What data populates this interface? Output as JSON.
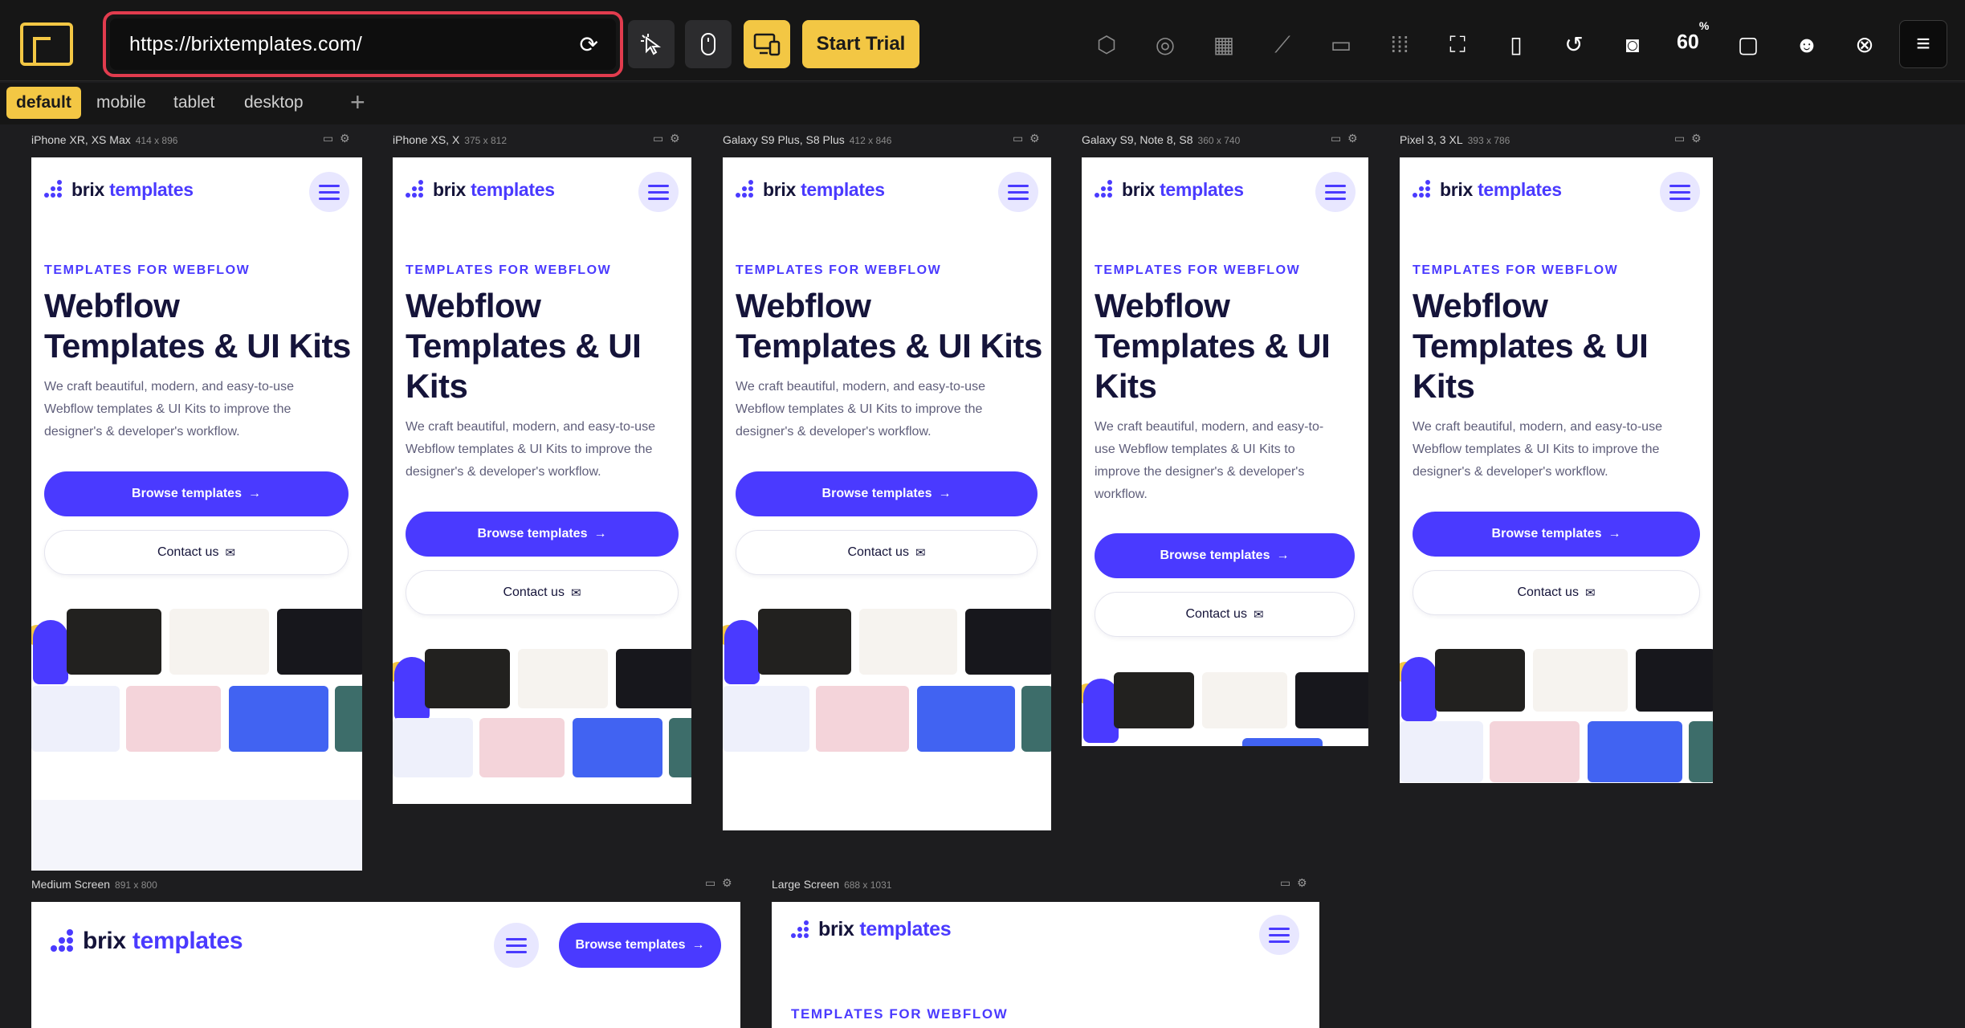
{
  "toolbar": {
    "url": "https://brixtemplates.com/",
    "start_trial_label": "Start Trial",
    "zoom_value": "60",
    "zoom_unit": "%",
    "icons": [
      "cube-icon",
      "layers-icon",
      "grid-icon",
      "ruler-icon",
      "minus-icon",
      "dots-grid-icon",
      "screenshot-frame-icon",
      "panel-icon",
      "rotate-icon",
      "camera-icon",
      "zoom-icon",
      "device-rotate-icon",
      "discord-icon",
      "close-circle-icon",
      "menu-icon"
    ],
    "accent_color": "#f3c744",
    "url_border_color": "#e23c4e"
  },
  "tabs": {
    "default": "default",
    "mobile": "mobile",
    "tablet": "tablet",
    "desktop": "desktop",
    "add": "+"
  },
  "site": {
    "brand_prefix": "brix",
    "brand_suffix": "templates",
    "eyebrow": "TEMPLATES FOR WEBFLOW",
    "headline_a1": "Webflow",
    "headline_a2": "Templates & UI Kits",
    "headline_b2": "Templates & UI",
    "headline_b3": "Kits",
    "para_a1": "We craft beautiful, modern, and easy-to-use",
    "para_a2": "Webflow templates & UI Kits to improve the",
    "para_a3": "designer's & developer's workflow.",
    "para_s1": "We craft beautiful, modern, and easy-to-",
    "para_s2": "use Webflow templates & UI Kits to",
    "para_s3": "improve the designer's & developer's",
    "para_s4": "workflow.",
    "browse_label": "Browse templates",
    "contact_label": "Contact us",
    "brand_color": "#4a3aff"
  },
  "frames": [
    {
      "name": "iPhone XR, XS Max",
      "dims": "414 x 896"
    },
    {
      "name": "iPhone XS, X",
      "dims": "375 x 812"
    },
    {
      "name": "Galaxy S9 Plus, S8 Plus",
      "dims": "412 x 846"
    },
    {
      "name": "Galaxy S9, Note 8, S8",
      "dims": "360 x 740"
    },
    {
      "name": "Pixel 3, 3 XL",
      "dims": "393 x 786"
    },
    {
      "name": "Medium Screen",
      "dims": "891 x 800"
    },
    {
      "name": "Large Screen",
      "dims": "688 x 1031"
    }
  ]
}
